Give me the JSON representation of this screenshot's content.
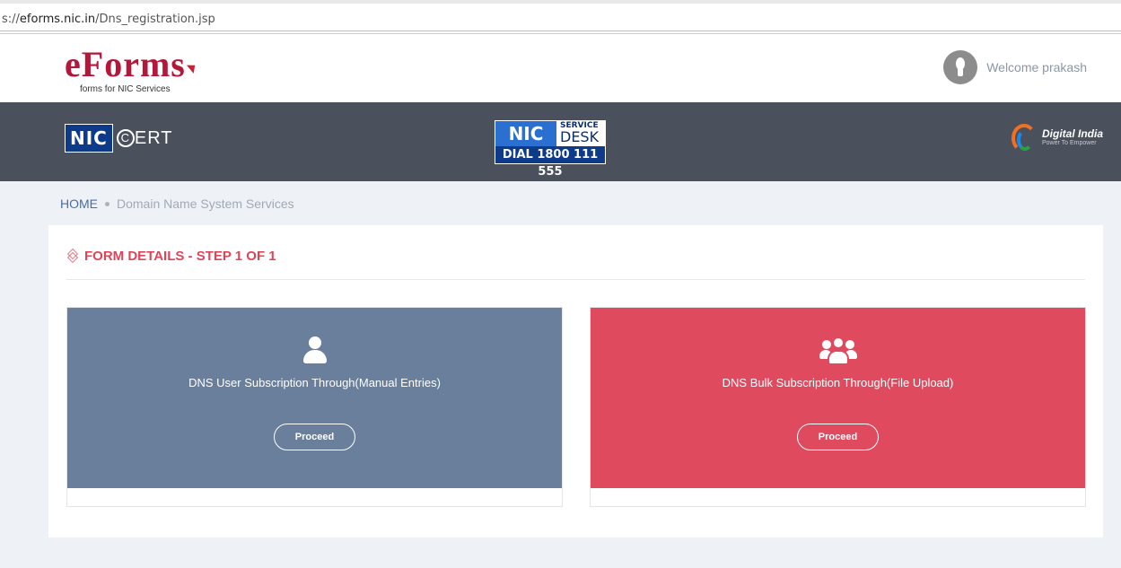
{
  "browser": {
    "url_prefix": "s://",
    "url_host": "eforms.nic.in",
    "url_path": "/Dns_registration.jsp"
  },
  "header": {
    "logo_text": "eForms",
    "logo_tagline": "forms for NIC Services",
    "welcome_text": "Welcome prakash"
  },
  "banner": {
    "nic_label": "NIC",
    "cert_label": "ERT",
    "cert_c": "C",
    "service_nic": "NIC",
    "service_word1": "SERVICE",
    "service_word2": "DESK",
    "service_dial": "DIAL 1800 111 555",
    "digital_india": "Digital India",
    "digital_tagline": "Power To Empower"
  },
  "breadcrumb": {
    "home": "HOME",
    "current": "Domain Name System Services"
  },
  "form": {
    "title": "FORM DETAILS - STEP 1 OF 1",
    "cards": [
      {
        "label": "DNS User Subscription Through(Manual Entries)",
        "button": "Proceed",
        "icon": "user-icon",
        "color": "#6a7f9c"
      },
      {
        "label": "DNS Bulk Subscription Through(File Upload)",
        "button": "Proceed",
        "icon": "users-icon",
        "color": "#e04a5e"
      }
    ]
  },
  "colors": {
    "accent": "#e04458",
    "banner_bg": "#4a515d",
    "page_bg": "#eef1f5"
  }
}
